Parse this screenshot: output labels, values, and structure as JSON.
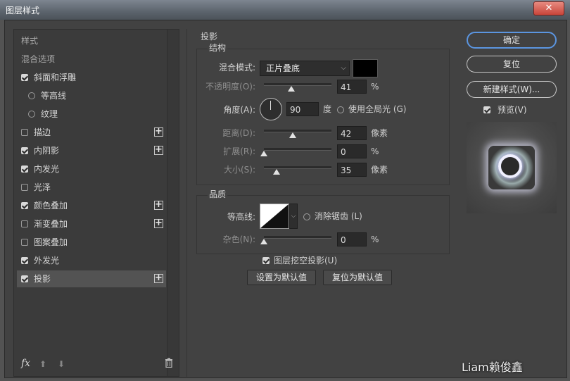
{
  "window": {
    "title": "图层样式",
    "close": "✕"
  },
  "left_panel": {
    "header_style": "样式",
    "header_blend": "混合选项",
    "items": [
      {
        "label": "斜面和浮雕",
        "checked": true,
        "plus": false
      },
      {
        "label": "等高线",
        "checked": false,
        "sub": true
      },
      {
        "label": "纹理",
        "checked": false,
        "sub": true
      },
      {
        "label": "描边",
        "checked": false,
        "plus": true
      },
      {
        "label": "内阴影",
        "checked": true,
        "plus": true
      },
      {
        "label": "内发光",
        "checked": true,
        "plus": false
      },
      {
        "label": "光泽",
        "checked": false,
        "plus": false
      },
      {
        "label": "颜色叠加",
        "checked": true,
        "plus": true
      },
      {
        "label": "渐变叠加",
        "checked": false,
        "plus": true
      },
      {
        "label": "图案叠加",
        "checked": false,
        "plus": false
      },
      {
        "label": "外发光",
        "checked": true,
        "plus": false
      },
      {
        "label": "投影",
        "checked": true,
        "plus": true,
        "selected": true
      }
    ],
    "plus_symbol": "+",
    "fx": "fx",
    "up": "⬆",
    "down": "⬇"
  },
  "shadow": {
    "title": "投影",
    "structure": {
      "title": "结构",
      "blend_mode_label": "混合模式:",
      "blend_mode_value": "正片叠底",
      "opacity_label": "不透明度(O):",
      "opacity_value": "41",
      "opacity_unit": "%",
      "opacity_level": 0.41,
      "angle_label": "角度(A):",
      "angle_value": "90",
      "angle_unit": "度",
      "global_light_label": "使用全局光 (G)",
      "distance_label": "距离(D):",
      "distance_value": "42",
      "distance_unit": "像素",
      "spread_label": "扩展(R):",
      "spread_value": "0",
      "spread_unit": "%",
      "size_label": "大小(S):",
      "size_value": "35",
      "size_unit": "像素"
    },
    "quality": {
      "title": "品质",
      "contour_label": "等高线:",
      "antialias_label": "消除锯齿 (L)",
      "noise_label": "杂色(N):",
      "noise_value": "0",
      "noise_unit": "%"
    },
    "knockout_label": "图层挖空投影(U)",
    "set_default": "设置为默认值",
    "reset_default": "复位为默认值"
  },
  "right_panel": {
    "ok": "确定",
    "reset": "复位",
    "new_style": "新建样式(W)...",
    "preview_label": "预览(V)"
  },
  "watermark": "Liam赖俊鑫"
}
